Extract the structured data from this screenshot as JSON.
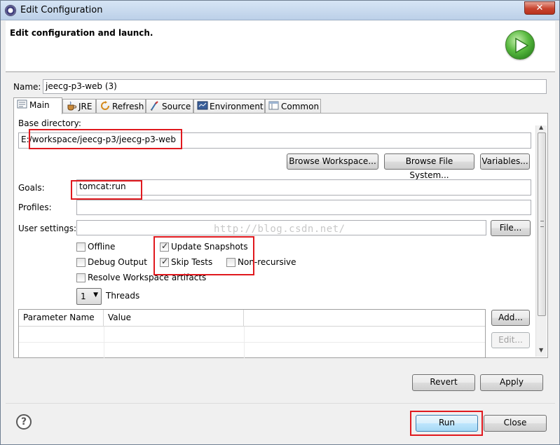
{
  "window": {
    "title": "Edit Configuration",
    "close_label": "✕"
  },
  "header": {
    "title": "Edit configuration and launch."
  },
  "name": {
    "label": "Name:",
    "value": "jeecg-p3-web (3)"
  },
  "tabs": [
    {
      "label": "Main",
      "icon": "main-tab-icon",
      "active": true
    },
    {
      "label": "JRE",
      "icon": "jre-icon"
    },
    {
      "label": "Refresh",
      "icon": "refresh-icon"
    },
    {
      "label": "Source",
      "icon": "source-icon"
    },
    {
      "label": "Environment",
      "icon": "environment-icon"
    },
    {
      "label": "Common",
      "icon": "common-icon"
    }
  ],
  "main": {
    "base_dir_label": "Base directory:",
    "base_dir_value": "E:/workspace/jeecg-p3/jeecg-p3-web",
    "browse_workspace": "Browse Workspace...",
    "browse_fs": "Browse File System...",
    "variables": "Variables...",
    "goals_label": "Goals:",
    "goals_value": "tomcat:run",
    "profiles_label": "Profiles:",
    "profiles_value": "",
    "user_settings_label": "User settings:",
    "user_settings_value": "",
    "file_button": "File...",
    "options": {
      "offline": {
        "label": "Offline",
        "checked": false
      },
      "update_snapshots": {
        "label": "Update Snapshots",
        "checked": true
      },
      "debug_output": {
        "label": "Debug Output",
        "checked": false
      },
      "skip_tests": {
        "label": "Skip Tests",
        "checked": true
      },
      "non_recursive": {
        "label": "Non-recursive",
        "checked": false
      },
      "resolve_workspace": {
        "label": "Resolve Workspace artifacts",
        "checked": false
      }
    },
    "threads_value": "1",
    "threads_label": "Threads",
    "param_columns": [
      "Parameter Name",
      "Value"
    ],
    "add_button": "Add...",
    "edit_button": "Edit..."
  },
  "watermark": "http://blog.csdn.net/",
  "footer": {
    "revert": "Revert",
    "apply": "Apply",
    "run": "Run",
    "close": "Close",
    "help": "?"
  },
  "colors": {
    "highlight": "#e0191e",
    "run_icon": "#58b93f"
  }
}
